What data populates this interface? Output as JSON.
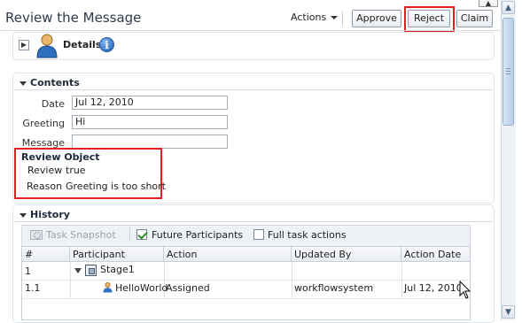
{
  "header": {
    "title": "Review the Message",
    "actions_label": "Actions",
    "buttons": {
      "approve": "Approve",
      "reject": "Reject",
      "claim": "Claim"
    }
  },
  "details": {
    "label": "Details",
    "info_glyph": "i"
  },
  "contents": {
    "title": "Contents",
    "fields": [
      {
        "label": "Date",
        "value": "Jul 12, 2010"
      },
      {
        "label": "Greeting",
        "value": "Hi"
      },
      {
        "label": "Message",
        "value": ""
      }
    ],
    "review_object": {
      "title": "Review Object",
      "review_label": "Review",
      "review_value": "true",
      "reason_label": "Reason",
      "reason_value": "Greeting is too short"
    }
  },
  "history": {
    "title": "History",
    "toolbar": {
      "snapshot": "Task Snapshot",
      "future_participants": "Future Participants",
      "full_task_actions": "Full task actions",
      "future_participants_checked": true,
      "full_task_actions_checked": false
    },
    "columns": [
      "#",
      "Participant",
      "Action",
      "Updated By",
      "Action Date"
    ],
    "rows": [
      {
        "num": "1",
        "participant": "Stage1",
        "action": "",
        "updated_by": "",
        "date": ""
      },
      {
        "num": "1.1",
        "participant": "HelloWorld",
        "action": "Assigned",
        "updated_by": "workflowsystem",
        "date": "Jul 12, 2010"
      }
    ]
  },
  "icons": {
    "person": "person-icon",
    "info": "info-icon",
    "snapshot": "camera-icon",
    "stage": "stage-icon",
    "user": "user-icon",
    "cursor": "mouse-pointer-icon"
  },
  "colors": {
    "highlight": "#e02020",
    "accent": "#1f5fb8"
  }
}
